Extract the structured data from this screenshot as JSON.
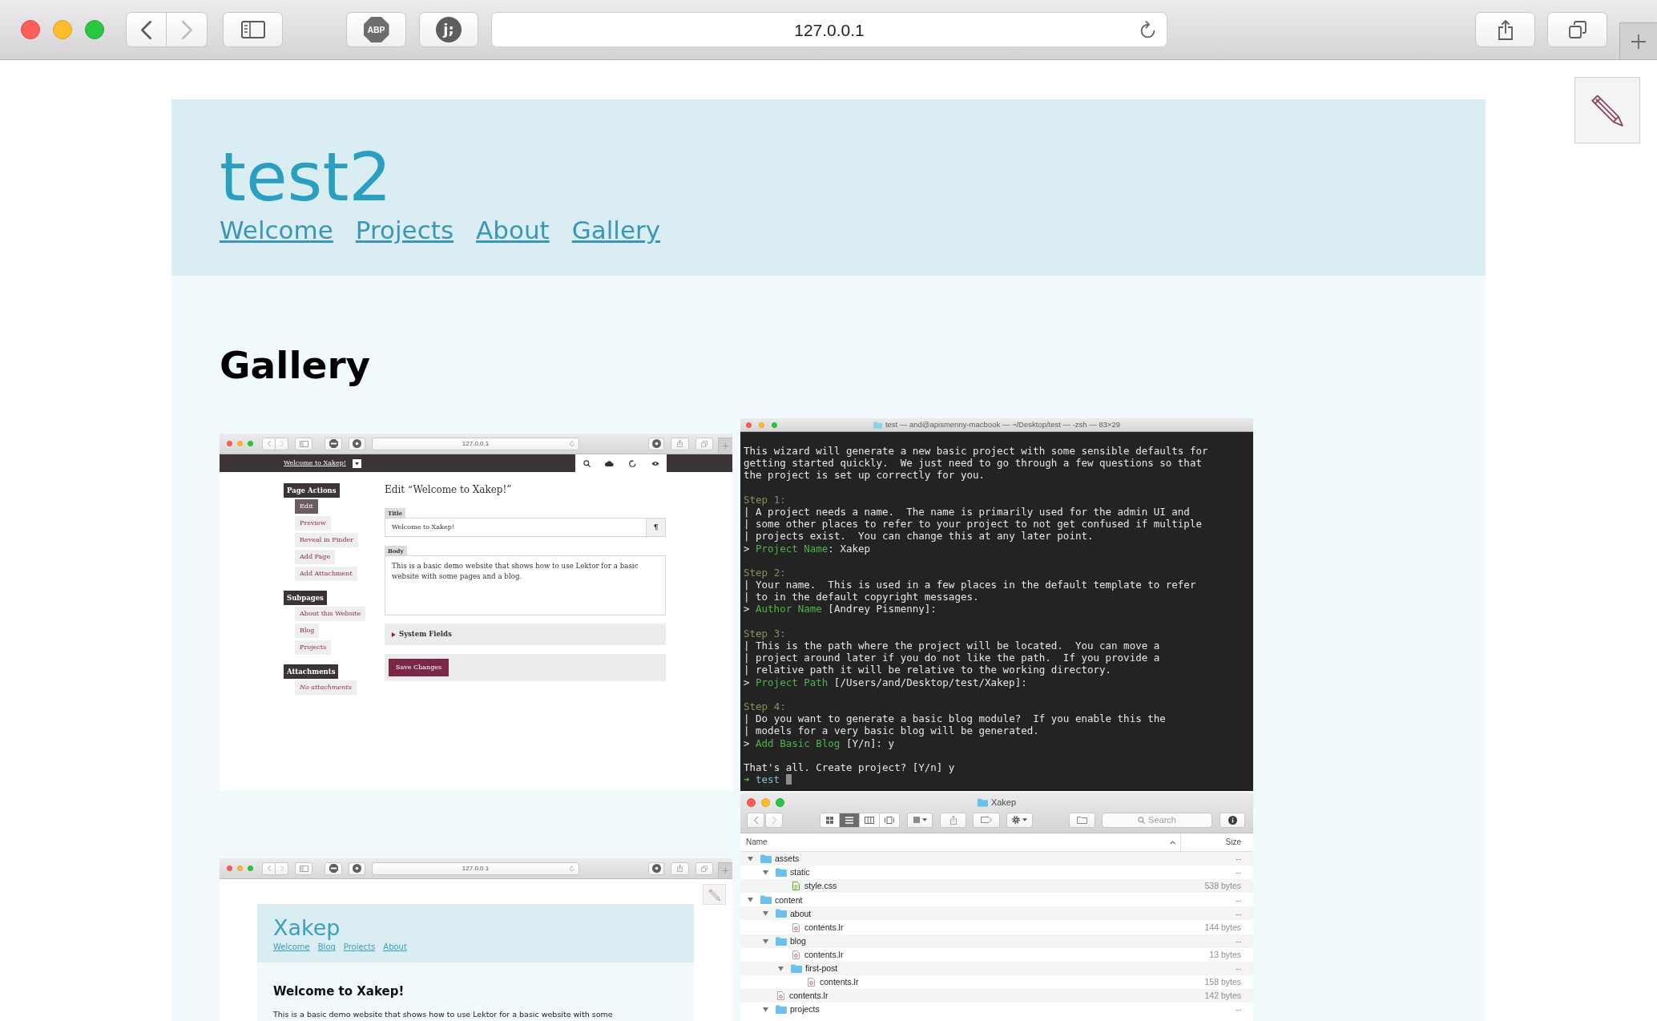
{
  "browser": {
    "back": {
      "disabled": false
    },
    "forward": {
      "disabled": true
    },
    "extensions": [
      {
        "kind": "octagon",
        "label": "ABP"
      },
      {
        "kind": "circle",
        "label": "j;"
      }
    ],
    "address": "127.0.0.1"
  },
  "site": {
    "title": "test2",
    "nav": [
      {
        "label": "Welcome"
      },
      {
        "label": "Projects"
      },
      {
        "label": "About"
      },
      {
        "label": "Gallery"
      }
    ],
    "heading": "Gallery"
  },
  "gallery": [
    {
      "kind": "admin",
      "address": "127.0.0.1",
      "page_link": "Welcome to Xakep!",
      "sidebar": [
        {
          "heading": "Page Actions",
          "items": [
            {
              "label": "Edit",
              "selected": true
            },
            {
              "label": "Preview",
              "selected": false
            },
            {
              "label": "Reveal in Finder",
              "selected": false
            },
            {
              "label": "Add Page",
              "selected": false
            },
            {
              "label": "Add Attachment",
              "selected": false
            }
          ]
        },
        {
          "heading": "Subpages",
          "items": [
            {
              "label": "About this Website",
              "selected": false
            },
            {
              "label": "Blog",
              "selected": false
            },
            {
              "label": "Projects",
              "selected": false
            }
          ]
        },
        {
          "heading": "Attachments",
          "note": "No attachments"
        }
      ],
      "editor": {
        "title": "Edit “Welcome to Xakep!”",
        "fields": [
          {
            "kind": "line",
            "label": "Title",
            "value": "Welcome to Xakep!",
            "button": "¶"
          },
          {
            "kind": "text",
            "label": "Body",
            "value": "This is a basic demo website that shows how to use Lektor for a basic website with some pages and a blog."
          }
        ],
        "system_fields": {
          "label": "System Fields",
          "expanded": false
        },
        "save_button": "Save Changes"
      }
    },
    {
      "kind": "terminal",
      "title": "test — and@apismenny-macbook — ~/Desktop/test — -zsh — 83×29",
      "paragraphs": [
        {
          "lines": [
            {
              "kind": "plain",
              "text": "This wizard will generate a new basic project with some sensible defaults for"
            },
            {
              "kind": "plain",
              "text": "getting started quickly.  We just need to go through a few questions so that"
            },
            {
              "kind": "plain",
              "text": "the project is set up correctly for you."
            }
          ]
        },
        {
          "lines": [
            {
              "kind": "step",
              "text": "Step 1:"
            },
            {
              "kind": "plain",
              "text": "| A project needs a name.  The name is primarily used for the admin UI and"
            },
            {
              "kind": "plain",
              "text": "| some other places to refer to your project to not get confused if multiple"
            },
            {
              "kind": "plain",
              "text": "| projects exist.  You can change this at any later point."
            },
            {
              "kind": "prompt",
              "marker": ">",
              "label": "Project Name",
              "text": ": Xakep"
            }
          ]
        },
        {
          "lines": [
            {
              "kind": "step",
              "text": "Step 2:"
            },
            {
              "kind": "plain",
              "text": "| Your name.  This is used in a few places in the default template to refer"
            },
            {
              "kind": "plain",
              "text": "| to in the default copyright messages."
            },
            {
              "kind": "prompt",
              "marker": ">",
              "label": "Author Name",
              "text": " [Andrey Pismenny]:"
            }
          ]
        },
        {
          "lines": [
            {
              "kind": "step",
              "text": "Step 3:"
            },
            {
              "kind": "plain",
              "text": "| This is the path where the project will be located.  You can move a"
            },
            {
              "kind": "plain",
              "text": "| project around later if you do not like the path.  If you provide a"
            },
            {
              "kind": "plain",
              "text": "| relative path it will be relative to the working directory."
            },
            {
              "kind": "prompt",
              "marker": ">",
              "label": "Project Path",
              "text": " [/Users/and/Desktop/test/Xakep]:"
            }
          ]
        },
        {
          "lines": [
            {
              "kind": "step",
              "text": "Step 4:"
            },
            {
              "kind": "plain",
              "text": "| Do you want to generate a basic blog module?  If you enable this the"
            },
            {
              "kind": "plain",
              "text": "| models for a very basic blog will be generated."
            },
            {
              "kind": "prompt",
              "marker": ">",
              "label": "Add Basic Blog",
              "text": " [Y/n]: y"
            }
          ]
        },
        {
          "lines": [
            {
              "kind": "plain",
              "text": "That's all. Create project? [Y/n] y"
            }
          ]
        }
      ],
      "prompt": {
        "arrow": "➜",
        "directory": "test",
        "cursor": true
      }
    },
    {
      "kind": "website",
      "address": "127.0.0.1",
      "site_title": "Xakep",
      "nav": [
        {
          "label": "Welcome"
        },
        {
          "label": "Blog"
        },
        {
          "label": "Projects"
        },
        {
          "label": "About"
        }
      ],
      "heading": "Welcome to Xakep!",
      "text": "This is a basic demo website that shows how to use Lektor for a basic website with some"
    },
    {
      "kind": "finder",
      "title": "Xakep",
      "view_modes": [
        {
          "kind": "icons",
          "selected": false
        },
        {
          "kind": "list",
          "selected": true
        },
        {
          "kind": "columns",
          "selected": false
        },
        {
          "kind": "cover_flow",
          "selected": false
        }
      ],
      "search_placeholder": "Search",
      "columns": [
        {
          "label": "Name",
          "sorted": true
        },
        {
          "label": "Size",
          "sorted": false
        }
      ],
      "tree": [
        {
          "kind": "folder",
          "name": "assets",
          "size": "--",
          "expanded": true,
          "children": [
            {
              "kind": "folder",
              "name": "static",
              "size": "--",
              "expanded": true,
              "children": [
                {
                  "kind": "stylesheet",
                  "name": "style.css",
                  "size": "538 bytes"
                }
              ]
            }
          ]
        },
        {
          "kind": "folder",
          "name": "content",
          "size": "--",
          "expanded": true,
          "children": [
            {
              "kind": "folder",
              "name": "about",
              "size": "--",
              "expanded": true,
              "children": [
                {
                  "kind": "document",
                  "name": "contents.lr",
                  "size": "144 bytes"
                }
              ]
            },
            {
              "kind": "folder",
              "name": "blog",
              "size": "--",
              "expanded": true,
              "children": [
                {
                  "kind": "document",
                  "name": "contents.lr",
                  "size": "13 bytes"
                },
                {
                  "kind": "folder",
                  "name": "first-post",
                  "size": "--",
                  "expanded": true,
                  "children": [
                    {
                      "kind": "document",
                      "name": "contents.lr",
                      "size": "158 bytes"
                    }
                  ]
                }
              ]
            },
            {
              "kind": "document",
              "name": "contents.lr",
              "size": "142 bytes"
            },
            {
              "kind": "folder",
              "name": "projects",
              "size": "--",
              "expanded": true
            }
          ]
        }
      ]
    }
  ]
}
